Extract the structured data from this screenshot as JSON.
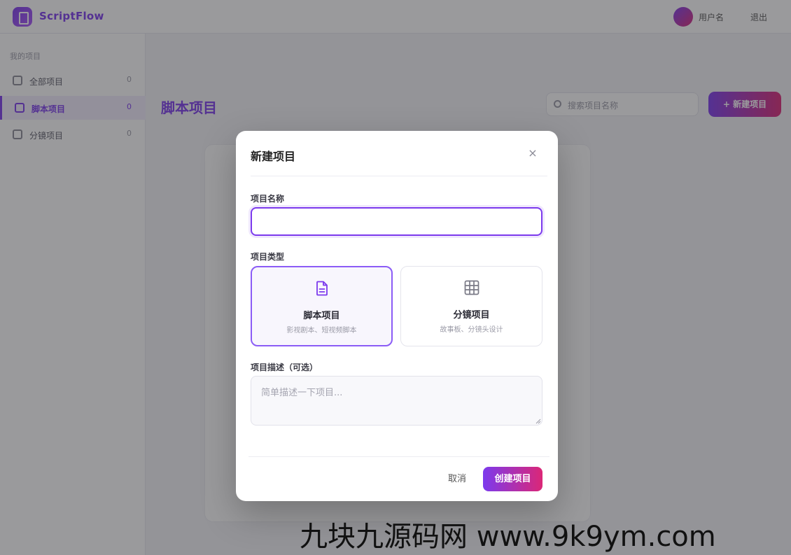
{
  "app": {
    "name": "ScriptFlow",
    "user_name": "用户名",
    "top_link": "退出",
    "accent_color": "#7c3aed",
    "accent_gradient_end": "#db2777"
  },
  "sidebar": {
    "section_title": "我的项目",
    "items": [
      {
        "label": "全部项目",
        "count": "0",
        "icon": "grid-icon"
      },
      {
        "label": "脚本项目",
        "count": "0",
        "icon": "document-icon"
      },
      {
        "label": "分镜项目",
        "count": "0",
        "icon": "storyboard-icon"
      }
    ]
  },
  "main": {
    "page_title": "脚本项目",
    "search_placeholder": "搜索项目名称",
    "new_button_label": "+ 新建项目"
  },
  "modal": {
    "title": "新建项目",
    "close_icon": "×",
    "name_label": "项目名称",
    "name_value": "",
    "type_label": "项目类型",
    "types": [
      {
        "title": "脚本项目",
        "subtitle": "影视剧本、短视频脚本",
        "icon": "document-icon",
        "selected": true
      },
      {
        "title": "分镜项目",
        "subtitle": "故事板、分镜头设计",
        "icon": "storyboard-grid-icon",
        "selected": false
      }
    ],
    "desc_label": "项目描述（可选）",
    "desc_placeholder": "简单描述一下项目...",
    "cancel_label": "取消",
    "create_label": "创建项目"
  },
  "watermark": {
    "text": "九块九源码网 www.9k9ym.com"
  }
}
